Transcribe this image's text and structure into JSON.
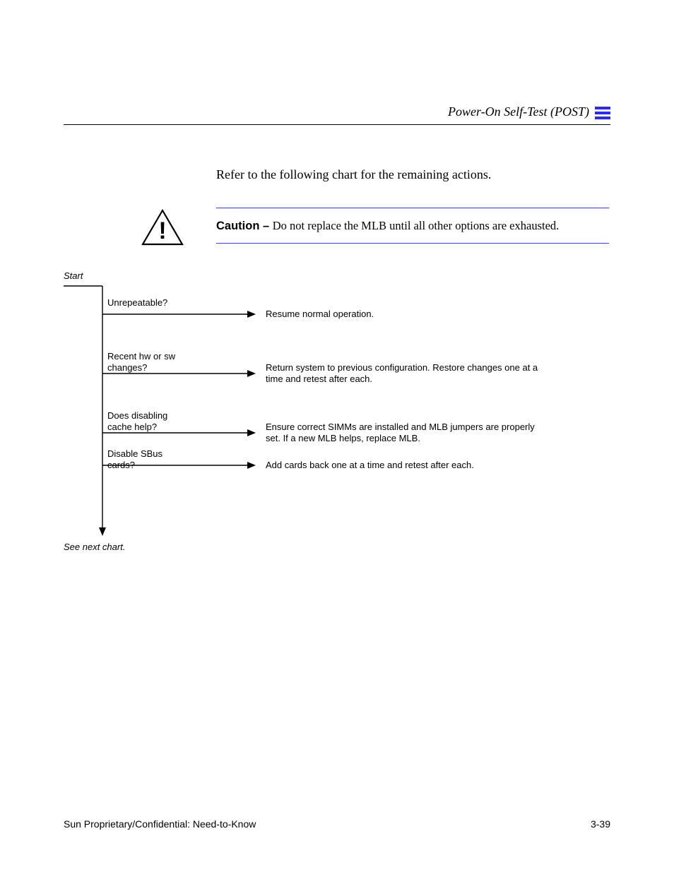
{
  "header": {
    "chapter_line": "Power-On Self-Test (POST)"
  },
  "intro_text": "Refer to the following chart for the remaining actions.",
  "caution": {
    "label": "Caution –",
    "text": "Do not replace the MLB until all other options are exhausted."
  },
  "flow": {
    "start": "Start",
    "q_unrepeatable": {
      "prompt": "Unrepeatable?",
      "yes_action": "Resume normal operation."
    },
    "q_recent_changes": {
      "prompt": "Recent hw or sw\nchanges?",
      "yes_action": "Return system to previous configuration. Restore changes one at a\ntime and retest after each."
    },
    "q_cache_disable": {
      "prompt": "Does disabling\ncache help?",
      "yes_action": "Ensure correct SIMMs are installed and MLB jumpers are properly\nset. If a new MLB helps, replace MLB."
    },
    "q_disable_sbus": {
      "prompt": "Disable SBus\ncards?",
      "yes_action": "Add cards back one at a time and retest after each."
    },
    "continue": "See next chart."
  },
  "footer": {
    "page_number": "3-39",
    "doc_title": "Sun Proprietary/Confidential: Need-to-Know"
  }
}
